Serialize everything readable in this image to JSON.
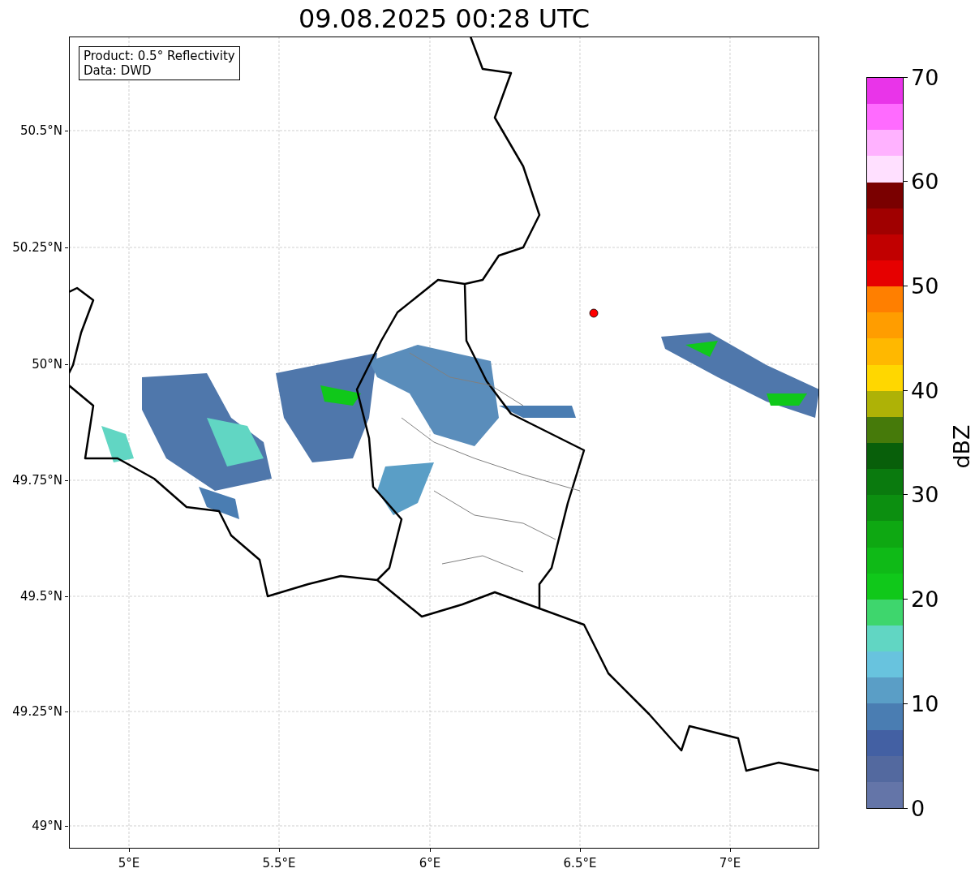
{
  "title": "09.08.2025 00:28 UTC",
  "map": {
    "legend": [
      "Product: 0.5° Reflectivity",
      "Data: DWD"
    ],
    "y_ticks": [
      "50.5°N",
      "50.25°N",
      "50°N",
      "49.75°N",
      "49.5°N",
      "49.25°N",
      "49°N"
    ],
    "x_ticks": [
      "5°E",
      "5.5°E",
      "6°E",
      "6.5°E",
      "7°E"
    ]
  },
  "colorbar": {
    "label": "dBZ",
    "ticks": [
      "70",
      "60",
      "50",
      "40",
      "30",
      "20",
      "10",
      "0"
    ],
    "bins": [
      {
        "color": "#e934e9"
      },
      {
        "color": "#ff6bff"
      },
      {
        "color": "#ffb2ff"
      },
      {
        "color": "#ffe0ff"
      },
      {
        "color": "#7a0000"
      },
      {
        "color": "#a00000"
      },
      {
        "color": "#c10000"
      },
      {
        "color": "#e60000"
      },
      {
        "color": "#ff7f00"
      },
      {
        "color": "#ff9d00"
      },
      {
        "color": "#ffb800"
      },
      {
        "color": "#ffd700"
      },
      {
        "color": "#aeb206"
      },
      {
        "color": "#467a0a"
      },
      {
        "color": "#085f0a"
      },
      {
        "color": "#0a7a0e"
      },
      {
        "color": "#0c8f10"
      },
      {
        "color": "#0ea812"
      },
      {
        "color": "#0fba17"
      },
      {
        "color": "#10c81a"
      },
      {
        "color": "#3ed66d"
      },
      {
        "color": "#61d6c3"
      },
      {
        "color": "#68c3de"
      },
      {
        "color": "#5a9ec6"
      },
      {
        "color": "#4a7db2"
      },
      {
        "color": "#4360a3"
      },
      {
        "color": "#53699f"
      },
      {
        "color": "#6475a8"
      }
    ]
  }
}
